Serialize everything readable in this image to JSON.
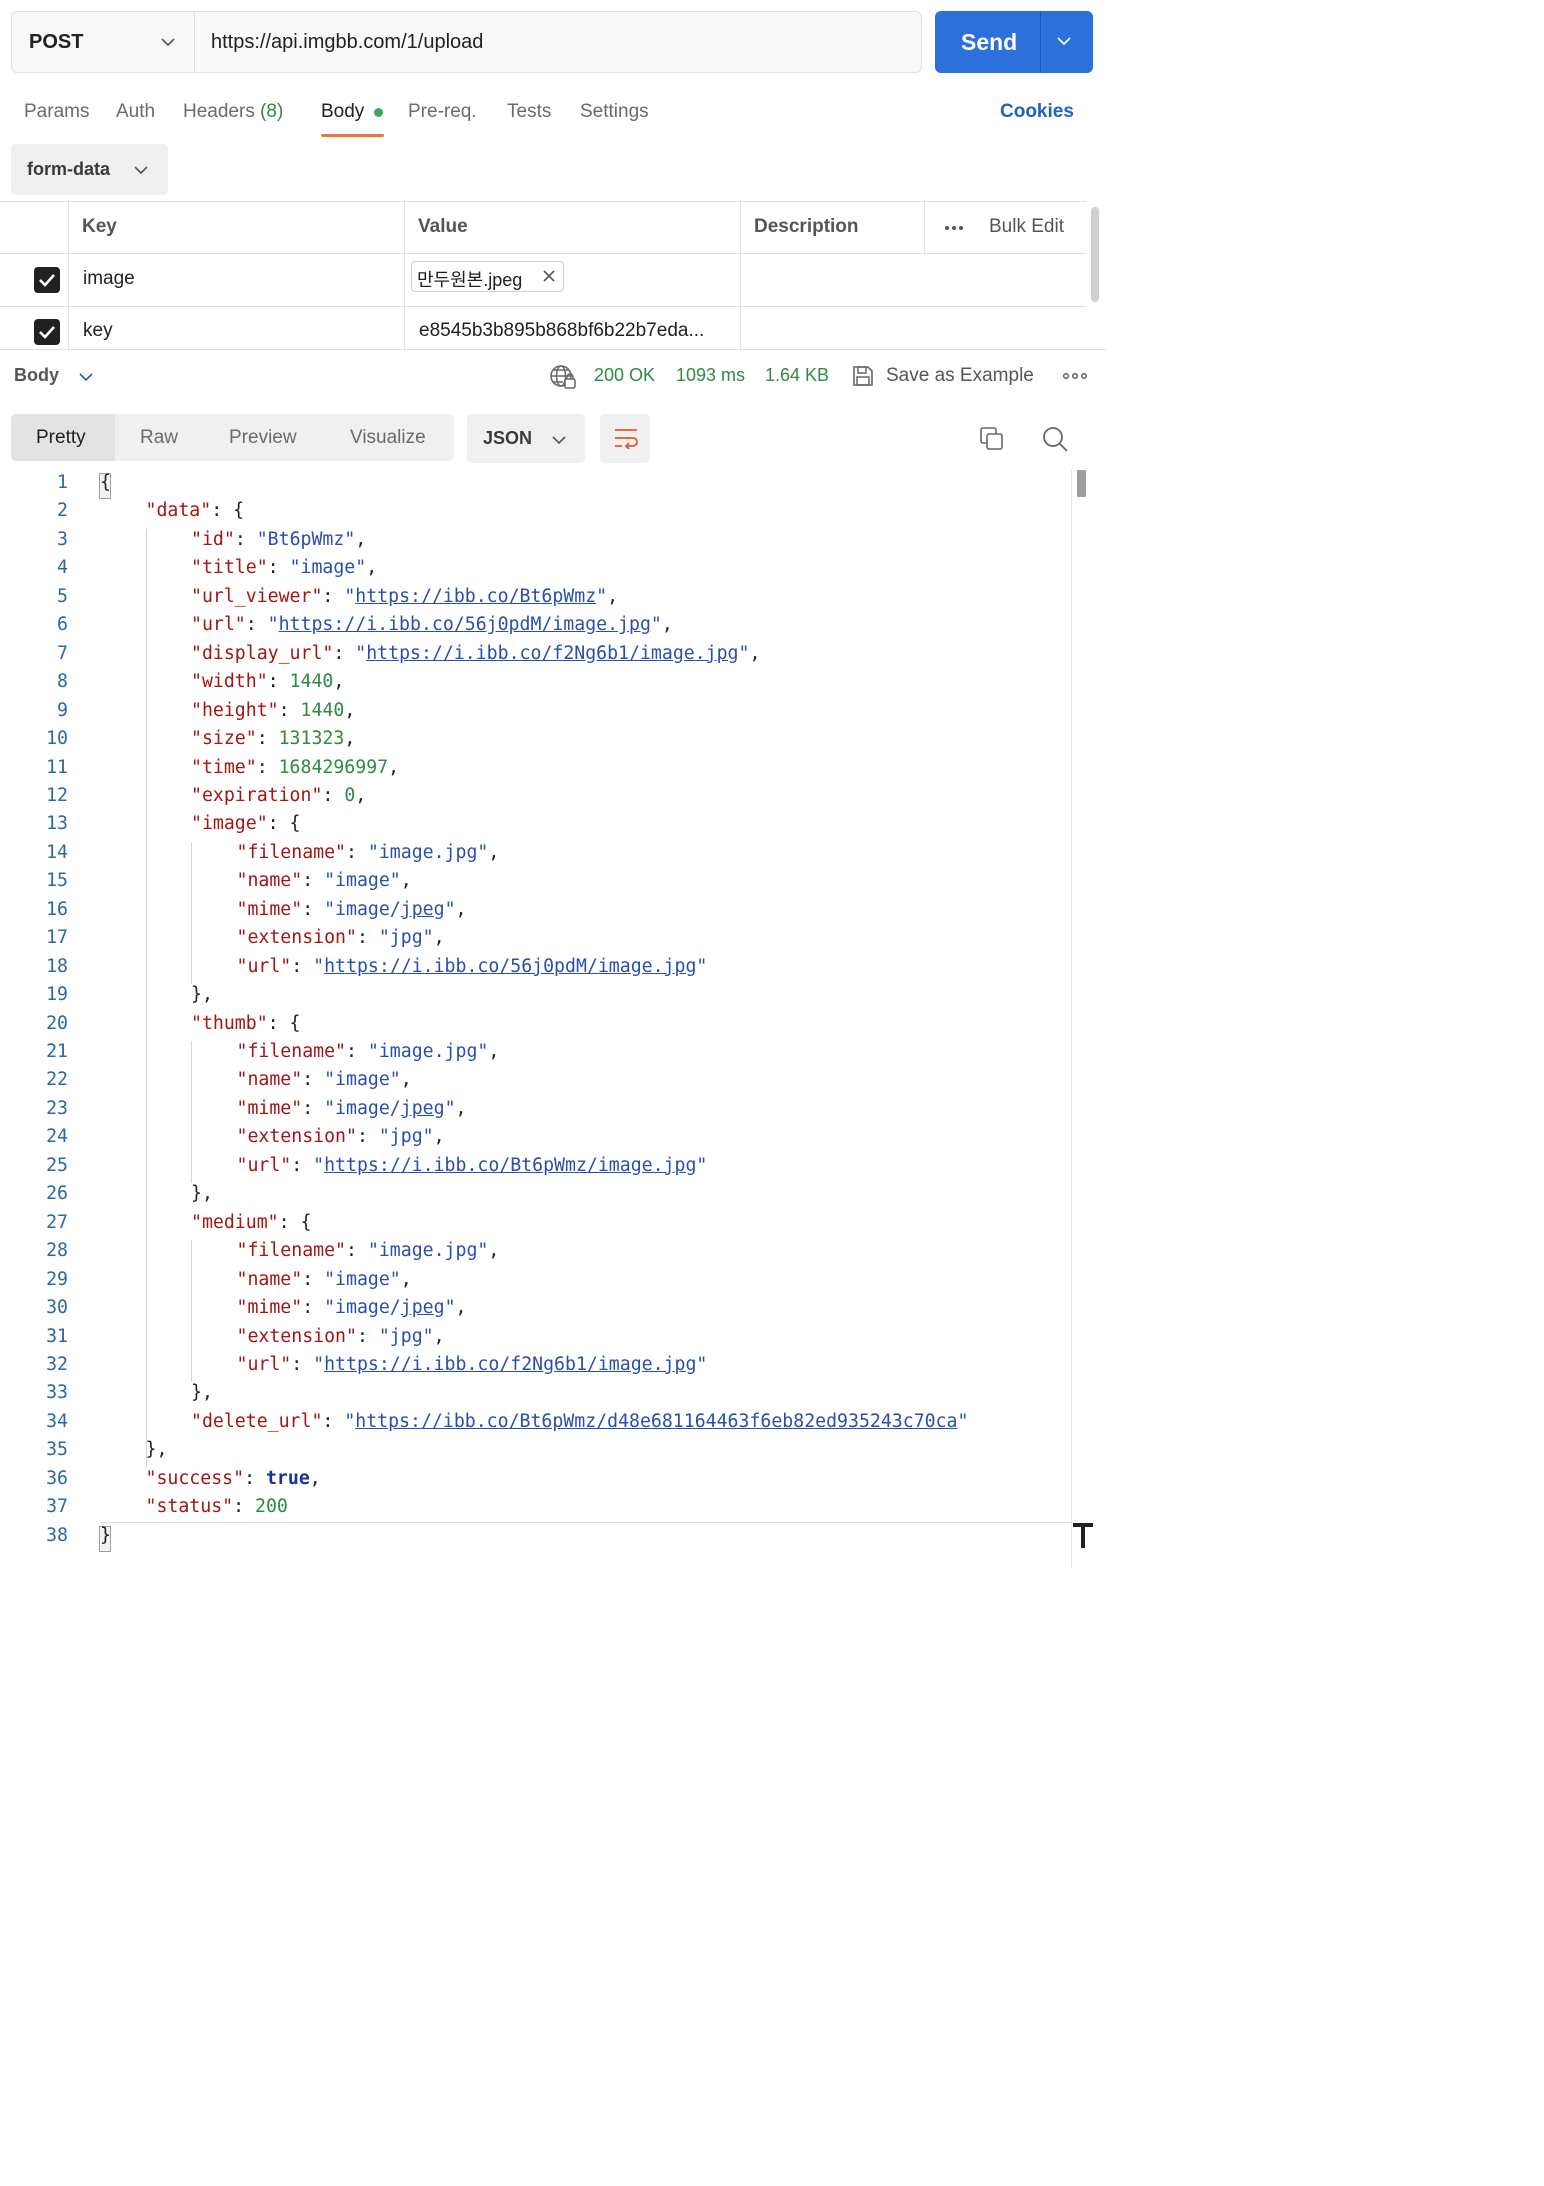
{
  "request": {
    "method": "POST",
    "url": "https://api.imgbb.com/1/upload",
    "send_label": "Send"
  },
  "tabs": [
    {
      "label": "Params"
    },
    {
      "label": "Auth"
    },
    {
      "label": "Headers",
      "count": "(8)"
    },
    {
      "label": "Body",
      "active": true
    },
    {
      "label": "Pre-req."
    },
    {
      "label": "Tests"
    },
    {
      "label": "Settings"
    }
  ],
  "cookies_label": "Cookies",
  "body_type": "form-data",
  "params_table": {
    "headers": {
      "key": "Key",
      "value": "Value",
      "description": "Description",
      "bulk_edit": "Bulk Edit"
    },
    "rows": [
      {
        "checked": true,
        "key": "image",
        "value": "만두원본.jpeg",
        "value_type": "file"
      },
      {
        "checked": true,
        "key": "key",
        "value": "e8545b3b895b868bf6b22b7eda..."
      }
    ]
  },
  "response": {
    "section_label": "Body",
    "status": "200 OK",
    "time": "1093 ms",
    "size": "1.64 KB",
    "save_as_example": "Save as Example",
    "view_modes": [
      "Pretty",
      "Raw",
      "Preview",
      "Visualize"
    ],
    "active_view": "Pretty",
    "format": "JSON"
  },
  "colors": {
    "send_button": "#2d6fdb",
    "active_tab_underline": "#e8773e",
    "status_ok": "#2f8a44",
    "json_key": "#a31515",
    "json_string": "#2a4faa",
    "json_number": "#2f8a44"
  },
  "icons": [
    "chevron-down-icon",
    "check-icon",
    "close-icon",
    "globe-lock-icon",
    "save-icon",
    "more-icon",
    "wrap-lines-icon",
    "copy-icon",
    "search-icon"
  ],
  "code_lines": [
    {
      "n": "1",
      "indent": 0,
      "parts": [
        [
          "p",
          "{"
        ]
      ]
    },
    {
      "n": "2",
      "indent": 1,
      "parts": [
        [
          "k",
          "\"data\""
        ],
        [
          "p",
          ": {"
        ]
      ]
    },
    {
      "n": "3",
      "indent": 2,
      "parts": [
        [
          "k",
          "\"id\""
        ],
        [
          "p",
          ": "
        ],
        [
          "s",
          "\"Bt6pWmz\""
        ],
        [
          "p",
          ","
        ]
      ]
    },
    {
      "n": "4",
      "indent": 2,
      "parts": [
        [
          "k",
          "\"title\""
        ],
        [
          "p",
          ": "
        ],
        [
          "s",
          "\"image\""
        ],
        [
          "p",
          ","
        ]
      ]
    },
    {
      "n": "5",
      "indent": 2,
      "parts": [
        [
          "k",
          "\"url_viewer\""
        ],
        [
          "p",
          ": "
        ],
        [
          "s",
          "\""
        ],
        [
          "u",
          "https://ibb.co/Bt6pWmz"
        ],
        [
          "s",
          "\""
        ],
        [
          "p",
          ","
        ]
      ]
    },
    {
      "n": "6",
      "indent": 2,
      "parts": [
        [
          "k",
          "\"url\""
        ],
        [
          "p",
          ": "
        ],
        [
          "s",
          "\""
        ],
        [
          "u",
          "https://i.ibb.co/56j0pdM/image.jpg"
        ],
        [
          "s",
          "\""
        ],
        [
          "p",
          ","
        ]
      ]
    },
    {
      "n": "7",
      "indent": 2,
      "parts": [
        [
          "k",
          "\"display_url\""
        ],
        [
          "p",
          ": "
        ],
        [
          "s",
          "\""
        ],
        [
          "u",
          "https://i.ibb.co/f2Ng6b1/image.jpg"
        ],
        [
          "s",
          "\""
        ],
        [
          "p",
          ","
        ]
      ]
    },
    {
      "n": "8",
      "indent": 2,
      "parts": [
        [
          "k",
          "\"width\""
        ],
        [
          "p",
          ": "
        ],
        [
          "n",
          "1440"
        ],
        [
          "p",
          ","
        ]
      ]
    },
    {
      "n": "9",
      "indent": 2,
      "parts": [
        [
          "k",
          "\"height\""
        ],
        [
          "p",
          ": "
        ],
        [
          "n",
          "1440"
        ],
        [
          "p",
          ","
        ]
      ]
    },
    {
      "n": "10",
      "indent": 2,
      "parts": [
        [
          "k",
          "\"size\""
        ],
        [
          "p",
          ": "
        ],
        [
          "n",
          "131323"
        ],
        [
          "p",
          ","
        ]
      ]
    },
    {
      "n": "11",
      "indent": 2,
      "parts": [
        [
          "k",
          "\"time\""
        ],
        [
          "p",
          ": "
        ],
        [
          "n",
          "1684296997"
        ],
        [
          "p",
          ","
        ]
      ]
    },
    {
      "n": "12",
      "indent": 2,
      "parts": [
        [
          "k",
          "\"expiration\""
        ],
        [
          "p",
          ": "
        ],
        [
          "n",
          "0"
        ],
        [
          "p",
          ","
        ]
      ]
    },
    {
      "n": "13",
      "indent": 2,
      "parts": [
        [
          "k",
          "\"image\""
        ],
        [
          "p",
          ": {"
        ]
      ]
    },
    {
      "n": "14",
      "indent": 3,
      "parts": [
        [
          "k",
          "\"filename\""
        ],
        [
          "p",
          ": "
        ],
        [
          "s",
          "\"image.jpg\""
        ],
        [
          "p",
          ","
        ]
      ]
    },
    {
      "n": "15",
      "indent": 3,
      "parts": [
        [
          "k",
          "\"name\""
        ],
        [
          "p",
          ": "
        ],
        [
          "s",
          "\"image\""
        ],
        [
          "p",
          ","
        ]
      ]
    },
    {
      "n": "16",
      "indent": 3,
      "parts": [
        [
          "k",
          "\"mime\""
        ],
        [
          "p",
          ": "
        ],
        [
          "s",
          "\"image/"
        ],
        [
          "u",
          "jpeg"
        ],
        [
          "s",
          "\""
        ],
        [
          "p",
          ","
        ]
      ]
    },
    {
      "n": "17",
      "indent": 3,
      "parts": [
        [
          "k",
          "\"extension\""
        ],
        [
          "p",
          ": "
        ],
        [
          "s",
          "\"jpg\""
        ],
        [
          "p",
          ","
        ]
      ]
    },
    {
      "n": "18",
      "indent": 3,
      "parts": [
        [
          "k",
          "\"url\""
        ],
        [
          "p",
          ": "
        ],
        [
          "s",
          "\""
        ],
        [
          "u",
          "https://i.ibb.co/56j0pdM/image.jpg"
        ],
        [
          "s",
          "\""
        ]
      ]
    },
    {
      "n": "19",
      "indent": 2,
      "parts": [
        [
          "p",
          "},"
        ]
      ]
    },
    {
      "n": "20",
      "indent": 2,
      "parts": [
        [
          "k",
          "\"thumb\""
        ],
        [
          "p",
          ": {"
        ]
      ]
    },
    {
      "n": "21",
      "indent": 3,
      "parts": [
        [
          "k",
          "\"filename\""
        ],
        [
          "p",
          ": "
        ],
        [
          "s",
          "\"image.jpg\""
        ],
        [
          "p",
          ","
        ]
      ]
    },
    {
      "n": "22",
      "indent": 3,
      "parts": [
        [
          "k",
          "\"name\""
        ],
        [
          "p",
          ": "
        ],
        [
          "s",
          "\"image\""
        ],
        [
          "p",
          ","
        ]
      ]
    },
    {
      "n": "23",
      "indent": 3,
      "parts": [
        [
          "k",
          "\"mime\""
        ],
        [
          "p",
          ": "
        ],
        [
          "s",
          "\"image/"
        ],
        [
          "u",
          "jpeg"
        ],
        [
          "s",
          "\""
        ],
        [
          "p",
          ","
        ]
      ]
    },
    {
      "n": "24",
      "indent": 3,
      "parts": [
        [
          "k",
          "\"extension\""
        ],
        [
          "p",
          ": "
        ],
        [
          "s",
          "\"jpg\""
        ],
        [
          "p",
          ","
        ]
      ]
    },
    {
      "n": "25",
      "indent": 3,
      "parts": [
        [
          "k",
          "\"url\""
        ],
        [
          "p",
          ": "
        ],
        [
          "s",
          "\""
        ],
        [
          "u",
          "https://i.ibb.co/Bt6pWmz/image.jpg"
        ],
        [
          "s",
          "\""
        ]
      ]
    },
    {
      "n": "26",
      "indent": 2,
      "parts": [
        [
          "p",
          "},"
        ]
      ]
    },
    {
      "n": "27",
      "indent": 2,
      "parts": [
        [
          "k",
          "\"medium\""
        ],
        [
          "p",
          ": {"
        ]
      ]
    },
    {
      "n": "28",
      "indent": 3,
      "parts": [
        [
          "k",
          "\"filename\""
        ],
        [
          "p",
          ": "
        ],
        [
          "s",
          "\"image.jpg\""
        ],
        [
          "p",
          ","
        ]
      ]
    },
    {
      "n": "29",
      "indent": 3,
      "parts": [
        [
          "k",
          "\"name\""
        ],
        [
          "p",
          ": "
        ],
        [
          "s",
          "\"image\""
        ],
        [
          "p",
          ","
        ]
      ]
    },
    {
      "n": "30",
      "indent": 3,
      "parts": [
        [
          "k",
          "\"mime\""
        ],
        [
          "p",
          ": "
        ],
        [
          "s",
          "\"image/"
        ],
        [
          "u",
          "jpeg"
        ],
        [
          "s",
          "\""
        ],
        [
          "p",
          ","
        ]
      ]
    },
    {
      "n": "31",
      "indent": 3,
      "parts": [
        [
          "k",
          "\"extension\""
        ],
        [
          "p",
          ": "
        ],
        [
          "s",
          "\"jpg\""
        ],
        [
          "p",
          ","
        ]
      ]
    },
    {
      "n": "32",
      "indent": 3,
      "parts": [
        [
          "k",
          "\"url\""
        ],
        [
          "p",
          ": "
        ],
        [
          "s",
          "\""
        ],
        [
          "u",
          "https://i.ibb.co/f2Ng6b1/image.jpg"
        ],
        [
          "s",
          "\""
        ]
      ]
    },
    {
      "n": "33",
      "indent": 2,
      "parts": [
        [
          "p",
          "},"
        ]
      ]
    },
    {
      "n": "34",
      "indent": 2,
      "parts": [
        [
          "k",
          "\"delete_url\""
        ],
        [
          "p",
          ": "
        ],
        [
          "s",
          "\""
        ],
        [
          "u",
          "https://ibb.co/Bt6pWmz/d48e681164463f6eb82ed935243c70ca"
        ],
        [
          "s",
          "\""
        ]
      ]
    },
    {
      "n": "35",
      "indent": 1,
      "parts": [
        [
          "p",
          "},"
        ]
      ]
    },
    {
      "n": "36",
      "indent": 1,
      "parts": [
        [
          "k",
          "\"success\""
        ],
        [
          "p",
          ": "
        ],
        [
          "b",
          "true"
        ],
        [
          "p",
          ","
        ]
      ]
    },
    {
      "n": "37",
      "indent": 1,
      "parts": [
        [
          "k",
          "\"status\""
        ],
        [
          "p",
          ": "
        ],
        [
          "n",
          "200"
        ]
      ]
    },
    {
      "n": "38",
      "indent": 0,
      "parts": [
        [
          "p",
          "}"
        ]
      ]
    }
  ]
}
